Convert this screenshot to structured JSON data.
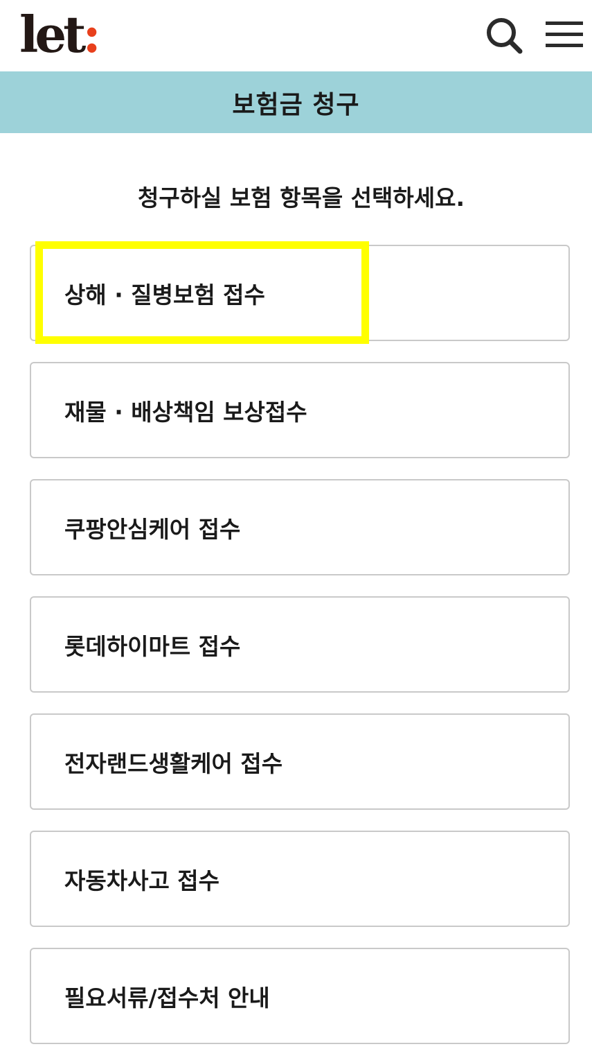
{
  "header": {
    "logo_text": "let",
    "logo_colon": ":",
    "logo_accent_color": "#e8401c",
    "search_icon": "search-icon",
    "menu_icon": "hamburger-menu-icon"
  },
  "title_bar": {
    "title": "보험금 청구",
    "background_color": "#9dd2d9"
  },
  "instruction": "청구하실 보험 항목을 선택하세요.",
  "options": [
    {
      "label": "상해 · 질병보험 접수"
    },
    {
      "label": "재물 · 배상책임 보상접수"
    },
    {
      "label": "쿠팡안심케어 접수"
    },
    {
      "label": "롯데하이마트 접수"
    },
    {
      "label": "전자랜드생활케어 접수"
    },
    {
      "label": "자동차사고 접수"
    },
    {
      "label": "필요서류/접수처 안내"
    }
  ],
  "highlight_color": "#ffff00"
}
